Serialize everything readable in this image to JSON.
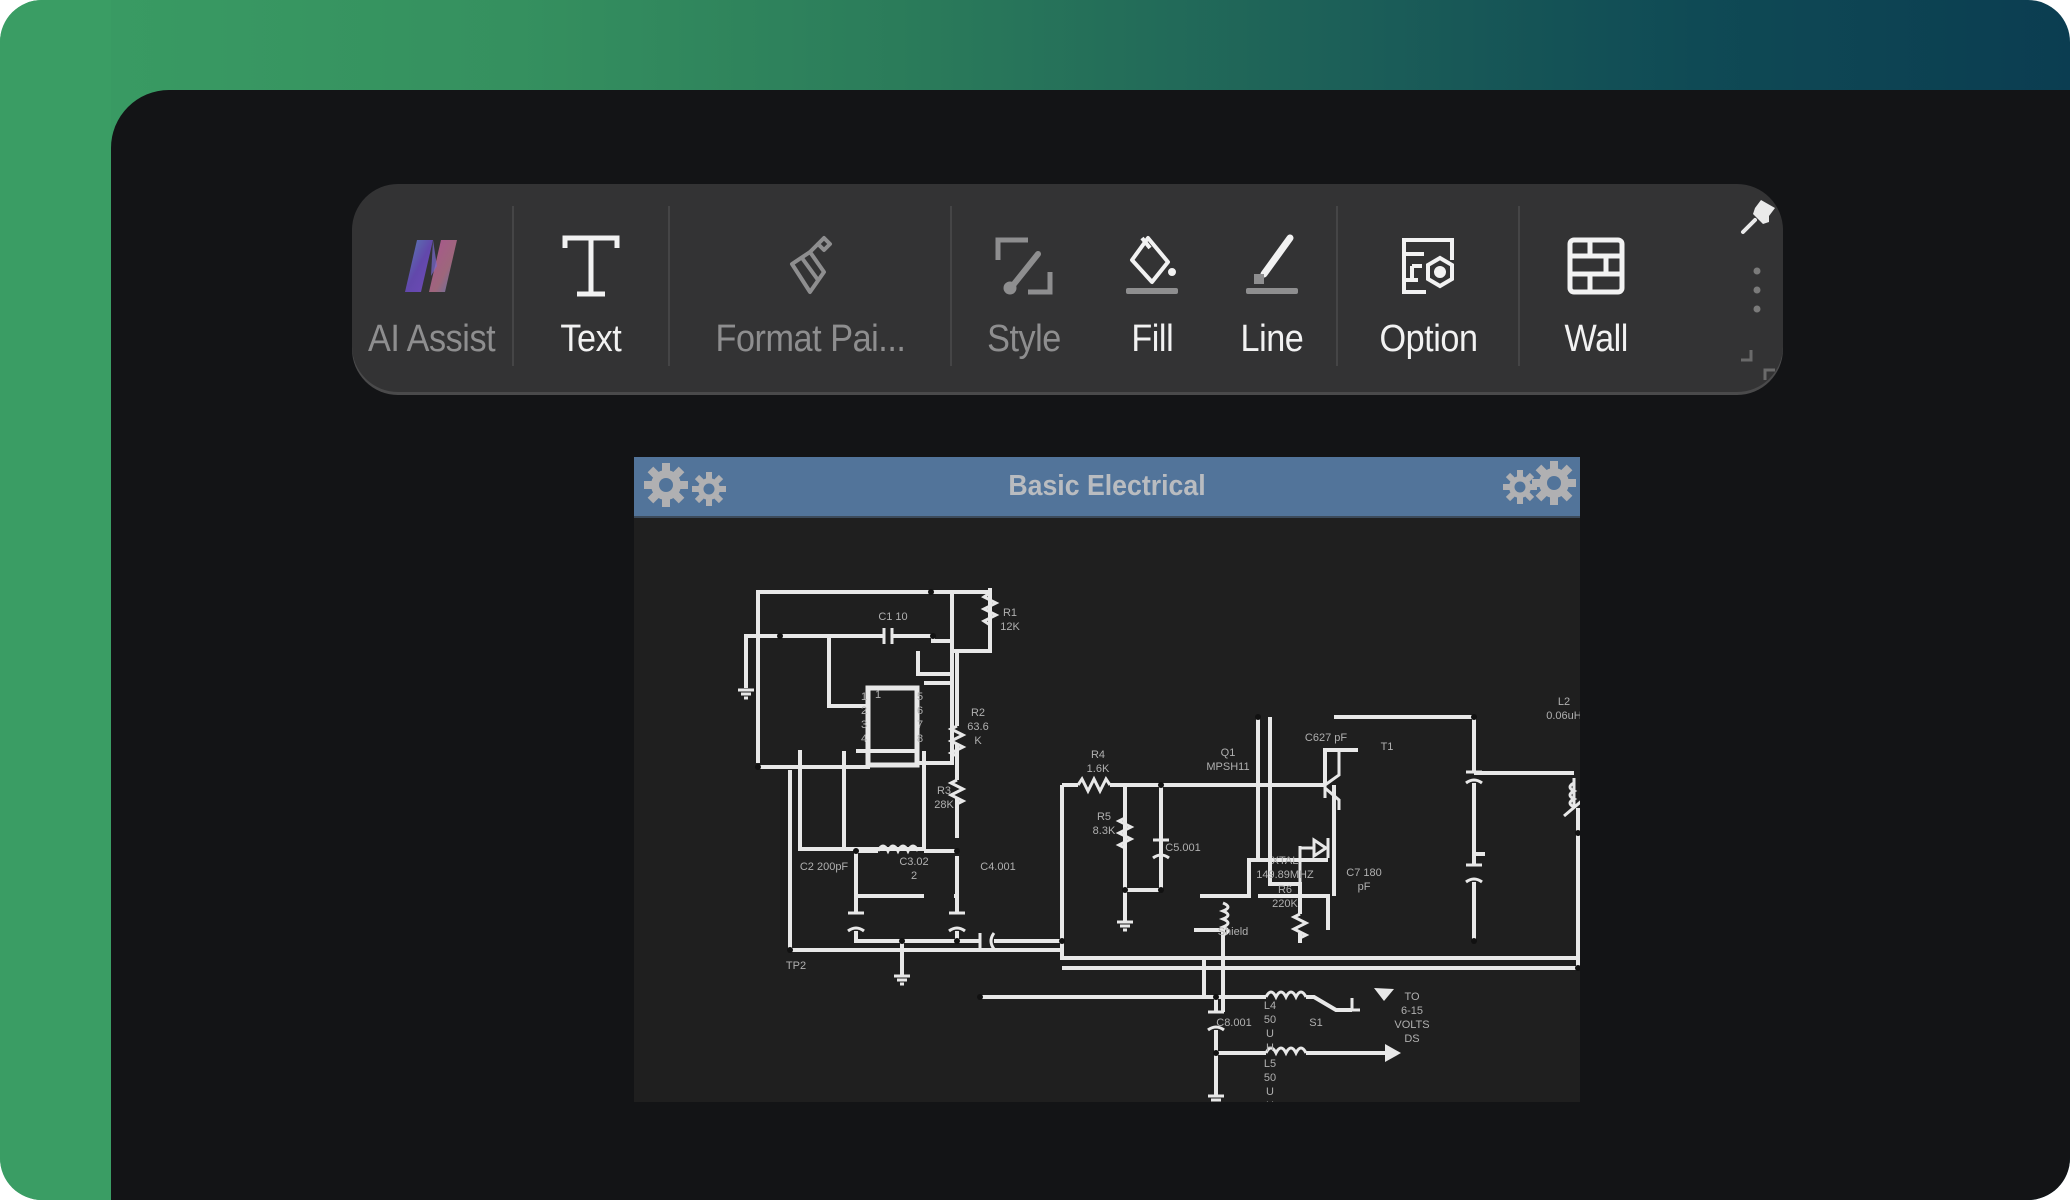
{
  "colors": {
    "frame_green": "#3a9d64",
    "frame_teal": "#0b3d51",
    "panel_bg": "#131416",
    "toolbar_bg": "#333334",
    "diagram_header": "#52749a",
    "diagram_bg": "#1f1f1f",
    "wire": "#e8e8e8",
    "label": "#b0b0b0"
  },
  "toolbar": {
    "items": [
      {
        "label": "AI Assist",
        "icon": "ai-assist-icon",
        "enabled": false
      },
      {
        "label": "Text",
        "icon": "text-icon",
        "enabled": true
      },
      {
        "label": "Format Pai...",
        "icon": "format-painter-icon",
        "enabled": false
      },
      {
        "label": "Style",
        "icon": "style-icon",
        "enabled": false
      },
      {
        "label": "Fill",
        "icon": "fill-icon",
        "enabled": true
      },
      {
        "label": "Line",
        "icon": "line-icon",
        "enabled": true
      },
      {
        "label": "Option",
        "icon": "option-icon",
        "enabled": true
      },
      {
        "label": "Wall",
        "icon": "wall-icon",
        "enabled": true
      }
    ],
    "pin_icon": "pin-icon",
    "more_icon": "more-vertical-icon",
    "resize_icon": "resize-corner-icon"
  },
  "diagram": {
    "title": "Basic Electrical",
    "left_icon": "gears-icon",
    "right_icon": "gears-icon",
    "labels": {
      "c1": [
        "C1 10"
      ],
      "r1": [
        "R1",
        "12K"
      ],
      "r2": [
        "R2",
        "63.6",
        "K"
      ],
      "r3": [
        "R3",
        "28K"
      ],
      "ic_pins_left": [
        "1",
        "2",
        "3",
        "4"
      ],
      "ic_pins_right": [
        "5",
        "6",
        "7",
        "8"
      ],
      "ic_pin_inner": "1",
      "c2": [
        "C2 200pF"
      ],
      "c3": [
        "C3.02",
        "2"
      ],
      "c4": [
        "C4.001"
      ],
      "tp2": [
        "TP2"
      ],
      "r4": [
        "R4",
        "1.6K"
      ],
      "r5": [
        "R5",
        "8.3K"
      ],
      "c5": [
        "C5.001"
      ],
      "q1": [
        "Q1",
        "MPSH11"
      ],
      "c6": [
        "C627 pF"
      ],
      "xtal": [
        "XTAL",
        "149.89MHZ"
      ],
      "r6": [
        "R6",
        "220K"
      ],
      "c7": [
        "C7 180",
        "pF"
      ],
      "t1": [
        "T1"
      ],
      "l2": [
        "L2",
        "0.06uH"
      ],
      "shield": [
        "Shield"
      ],
      "l4": [
        "L4",
        "50",
        "U",
        "H"
      ],
      "l5": [
        "L5",
        "50",
        "U",
        "H"
      ],
      "c8": [
        "C8.001"
      ],
      "s1": [
        "S1"
      ],
      "power": [
        "TO",
        "6-15",
        "VOLTS",
        "DS"
      ]
    }
  }
}
